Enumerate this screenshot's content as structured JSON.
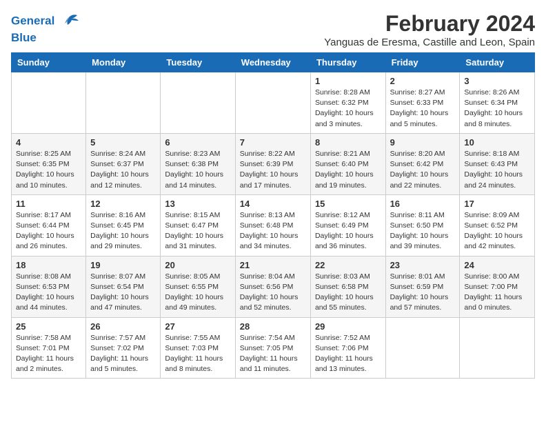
{
  "header": {
    "logo_line1": "General",
    "logo_line2": "Blue",
    "main_title": "February 2024",
    "subtitle": "Yanguas de Eresma, Castille and Leon, Spain"
  },
  "calendar": {
    "headers": [
      "Sunday",
      "Monday",
      "Tuesday",
      "Wednesday",
      "Thursday",
      "Friday",
      "Saturday"
    ],
    "weeks": [
      [
        {
          "day": "",
          "info": ""
        },
        {
          "day": "",
          "info": ""
        },
        {
          "day": "",
          "info": ""
        },
        {
          "day": "",
          "info": ""
        },
        {
          "day": "1",
          "info": "Sunrise: 8:28 AM\nSunset: 6:32 PM\nDaylight: 10 hours\nand 3 minutes."
        },
        {
          "day": "2",
          "info": "Sunrise: 8:27 AM\nSunset: 6:33 PM\nDaylight: 10 hours\nand 5 minutes."
        },
        {
          "day": "3",
          "info": "Sunrise: 8:26 AM\nSunset: 6:34 PM\nDaylight: 10 hours\nand 8 minutes."
        }
      ],
      [
        {
          "day": "4",
          "info": "Sunrise: 8:25 AM\nSunset: 6:35 PM\nDaylight: 10 hours\nand 10 minutes."
        },
        {
          "day": "5",
          "info": "Sunrise: 8:24 AM\nSunset: 6:37 PM\nDaylight: 10 hours\nand 12 minutes."
        },
        {
          "day": "6",
          "info": "Sunrise: 8:23 AM\nSunset: 6:38 PM\nDaylight: 10 hours\nand 14 minutes."
        },
        {
          "day": "7",
          "info": "Sunrise: 8:22 AM\nSunset: 6:39 PM\nDaylight: 10 hours\nand 17 minutes."
        },
        {
          "day": "8",
          "info": "Sunrise: 8:21 AM\nSunset: 6:40 PM\nDaylight: 10 hours\nand 19 minutes."
        },
        {
          "day": "9",
          "info": "Sunrise: 8:20 AM\nSunset: 6:42 PM\nDaylight: 10 hours\nand 22 minutes."
        },
        {
          "day": "10",
          "info": "Sunrise: 8:18 AM\nSunset: 6:43 PM\nDaylight: 10 hours\nand 24 minutes."
        }
      ],
      [
        {
          "day": "11",
          "info": "Sunrise: 8:17 AM\nSunset: 6:44 PM\nDaylight: 10 hours\nand 26 minutes."
        },
        {
          "day": "12",
          "info": "Sunrise: 8:16 AM\nSunset: 6:45 PM\nDaylight: 10 hours\nand 29 minutes."
        },
        {
          "day": "13",
          "info": "Sunrise: 8:15 AM\nSunset: 6:47 PM\nDaylight: 10 hours\nand 31 minutes."
        },
        {
          "day": "14",
          "info": "Sunrise: 8:13 AM\nSunset: 6:48 PM\nDaylight: 10 hours\nand 34 minutes."
        },
        {
          "day": "15",
          "info": "Sunrise: 8:12 AM\nSunset: 6:49 PM\nDaylight: 10 hours\nand 36 minutes."
        },
        {
          "day": "16",
          "info": "Sunrise: 8:11 AM\nSunset: 6:50 PM\nDaylight: 10 hours\nand 39 minutes."
        },
        {
          "day": "17",
          "info": "Sunrise: 8:09 AM\nSunset: 6:52 PM\nDaylight: 10 hours\nand 42 minutes."
        }
      ],
      [
        {
          "day": "18",
          "info": "Sunrise: 8:08 AM\nSunset: 6:53 PM\nDaylight: 10 hours\nand 44 minutes."
        },
        {
          "day": "19",
          "info": "Sunrise: 8:07 AM\nSunset: 6:54 PM\nDaylight: 10 hours\nand 47 minutes."
        },
        {
          "day": "20",
          "info": "Sunrise: 8:05 AM\nSunset: 6:55 PM\nDaylight: 10 hours\nand 49 minutes."
        },
        {
          "day": "21",
          "info": "Sunrise: 8:04 AM\nSunset: 6:56 PM\nDaylight: 10 hours\nand 52 minutes."
        },
        {
          "day": "22",
          "info": "Sunrise: 8:03 AM\nSunset: 6:58 PM\nDaylight: 10 hours\nand 55 minutes."
        },
        {
          "day": "23",
          "info": "Sunrise: 8:01 AM\nSunset: 6:59 PM\nDaylight: 10 hours\nand 57 minutes."
        },
        {
          "day": "24",
          "info": "Sunrise: 8:00 AM\nSunset: 7:00 PM\nDaylight: 11 hours\nand 0 minutes."
        }
      ],
      [
        {
          "day": "25",
          "info": "Sunrise: 7:58 AM\nSunset: 7:01 PM\nDaylight: 11 hours\nand 2 minutes."
        },
        {
          "day": "26",
          "info": "Sunrise: 7:57 AM\nSunset: 7:02 PM\nDaylight: 11 hours\nand 5 minutes."
        },
        {
          "day": "27",
          "info": "Sunrise: 7:55 AM\nSunset: 7:03 PM\nDaylight: 11 hours\nand 8 minutes."
        },
        {
          "day": "28",
          "info": "Sunrise: 7:54 AM\nSunset: 7:05 PM\nDaylight: 11 hours\nand 11 minutes."
        },
        {
          "day": "29",
          "info": "Sunrise: 7:52 AM\nSunset: 7:06 PM\nDaylight: 11 hours\nand 13 minutes."
        },
        {
          "day": "",
          "info": ""
        },
        {
          "day": "",
          "info": ""
        }
      ]
    ]
  }
}
